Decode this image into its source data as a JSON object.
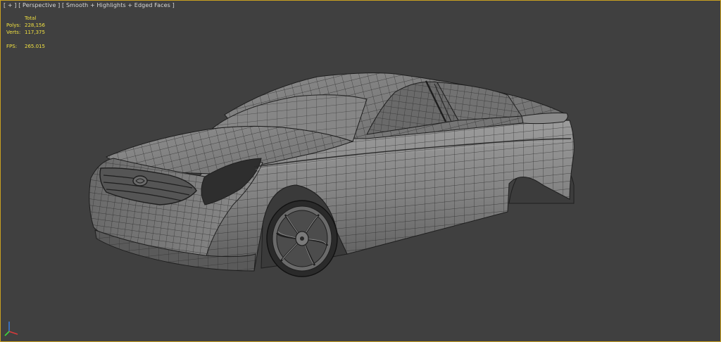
{
  "viewport": {
    "label_parts": [
      "[ + ]",
      "[ Perspective ]",
      "[ Smooth + Highlights + Edged Faces ]"
    ]
  },
  "stats": {
    "header": "Total",
    "polys_label": "Polys:",
    "polys_value": "228,156",
    "verts_label": "Verts:",
    "verts_value": "117,375",
    "fps_label": "FPS:",
    "fps_value": "265.015"
  },
  "colors": {
    "viewport_bg": "#404040",
    "active_border": "#c8a020",
    "stats_text": "#f0e040",
    "wire": "#1e1e1e",
    "shade_light": "#9a9a9a",
    "shade_mid": "#7c7c7c",
    "shade_dark": "#4a4a4a"
  },
  "gizmo": {
    "axes": [
      "x-axis",
      "y-axis",
      "z-axis"
    ]
  }
}
